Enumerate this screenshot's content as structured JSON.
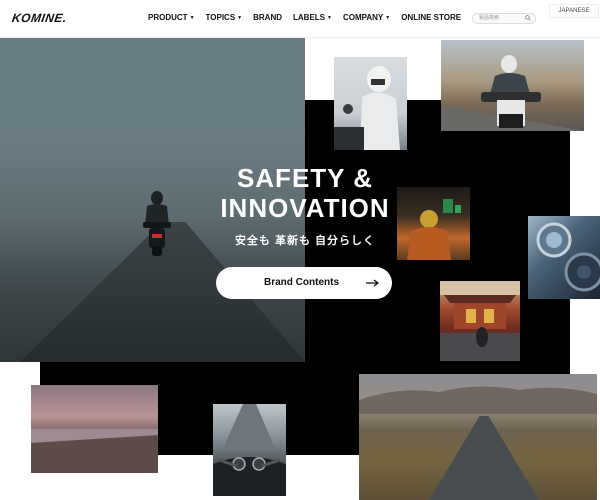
{
  "header": {
    "logo": "KOMINE.",
    "nav": [
      {
        "label": "PRODUCT",
        "dropdown": true
      },
      {
        "label": "TOPICS",
        "dropdown": true
      },
      {
        "label": "BRAND",
        "dropdown": false
      },
      {
        "label": "LABELS",
        "dropdown": true
      },
      {
        "label": "COMPANY",
        "dropdown": true
      },
      {
        "label": "ONLINE STORE",
        "dropdown": false
      }
    ],
    "search_placeholder": "製品検索",
    "language": "JAPANESE"
  },
  "hero": {
    "title_line1": "SAFETY &",
    "title_line2": "INNOVATION",
    "subtitle": "安全も 革新も 自分らしく",
    "button_label": "Brand Contents"
  },
  "colors": {
    "background": "#ffffff",
    "block": "#000000",
    "text": "#111111"
  },
  "icons": {
    "search": "search-icon",
    "arrow": "arrow-right-icon",
    "caret": "caret-down-icon"
  }
}
